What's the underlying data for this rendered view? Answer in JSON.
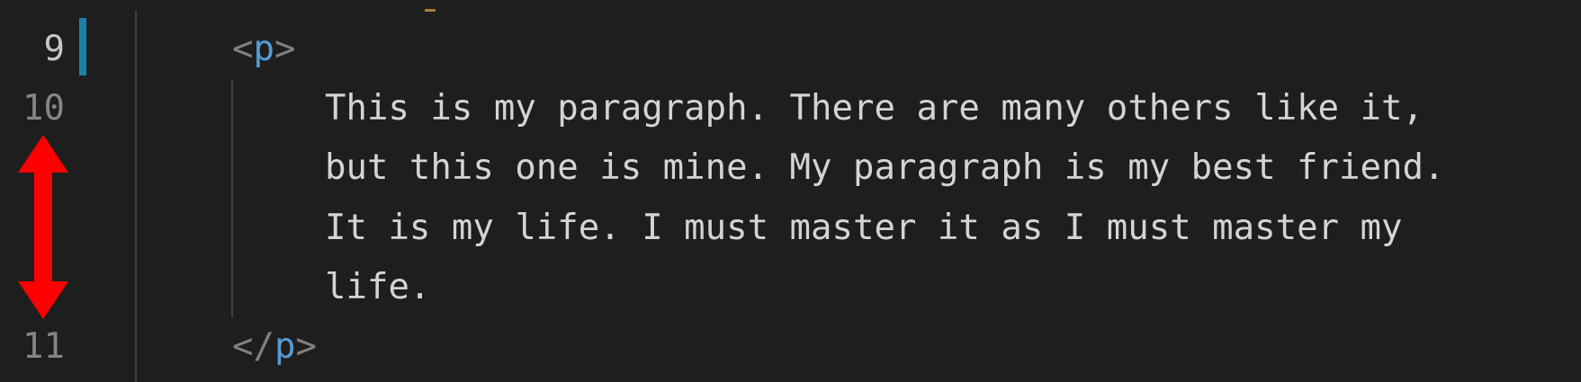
{
  "gutter": {
    "line_numbers": [
      "9",
      "10",
      "11"
    ]
  },
  "code": {
    "open_tag": {
      "lt": "<",
      "name": "p",
      "gt": ">"
    },
    "paragraph_lines": [
      "This is my paragraph. There are many others like it,",
      "but this one is mine. My paragraph is my best friend.",
      "It is my life. I must master it as I must master my",
      "life."
    ],
    "close_tag": {
      "lt": "</",
      "name": "p",
      "gt": ">"
    }
  },
  "colors": {
    "background": "#1e1e1e",
    "tag_name": "#569cd6",
    "tag_bracket": "#808080",
    "text": "#d4d4d4",
    "line_number": "#858585",
    "change_marker": "#1b81a8",
    "annotation_arrow": "#ff0000"
  },
  "icons": {
    "annotation": "double-headed-vertical-arrow"
  }
}
